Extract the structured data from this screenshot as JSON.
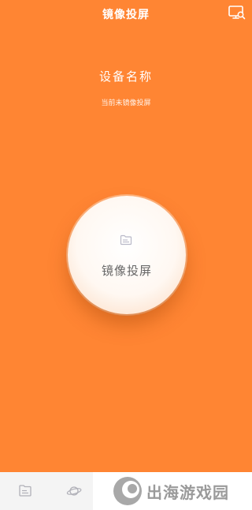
{
  "header": {
    "title": "镜像投屏",
    "screen_search_icon": "monitor-search-icon"
  },
  "device": {
    "name": "设备名称",
    "status": "当前未镜像投屏"
  },
  "cast_button": {
    "label": "镜像投屏",
    "icon": "file-icon"
  },
  "bottom_nav": {
    "tabs": [
      {
        "icon": "file-icon"
      },
      {
        "icon": "planet-icon"
      }
    ]
  },
  "watermark": {
    "text": "出海游戏园",
    "icon": "logo-icon"
  },
  "colors": {
    "accent": "#ff8533",
    "button_text": "#666666",
    "nav_background": "#f4f4f4"
  }
}
